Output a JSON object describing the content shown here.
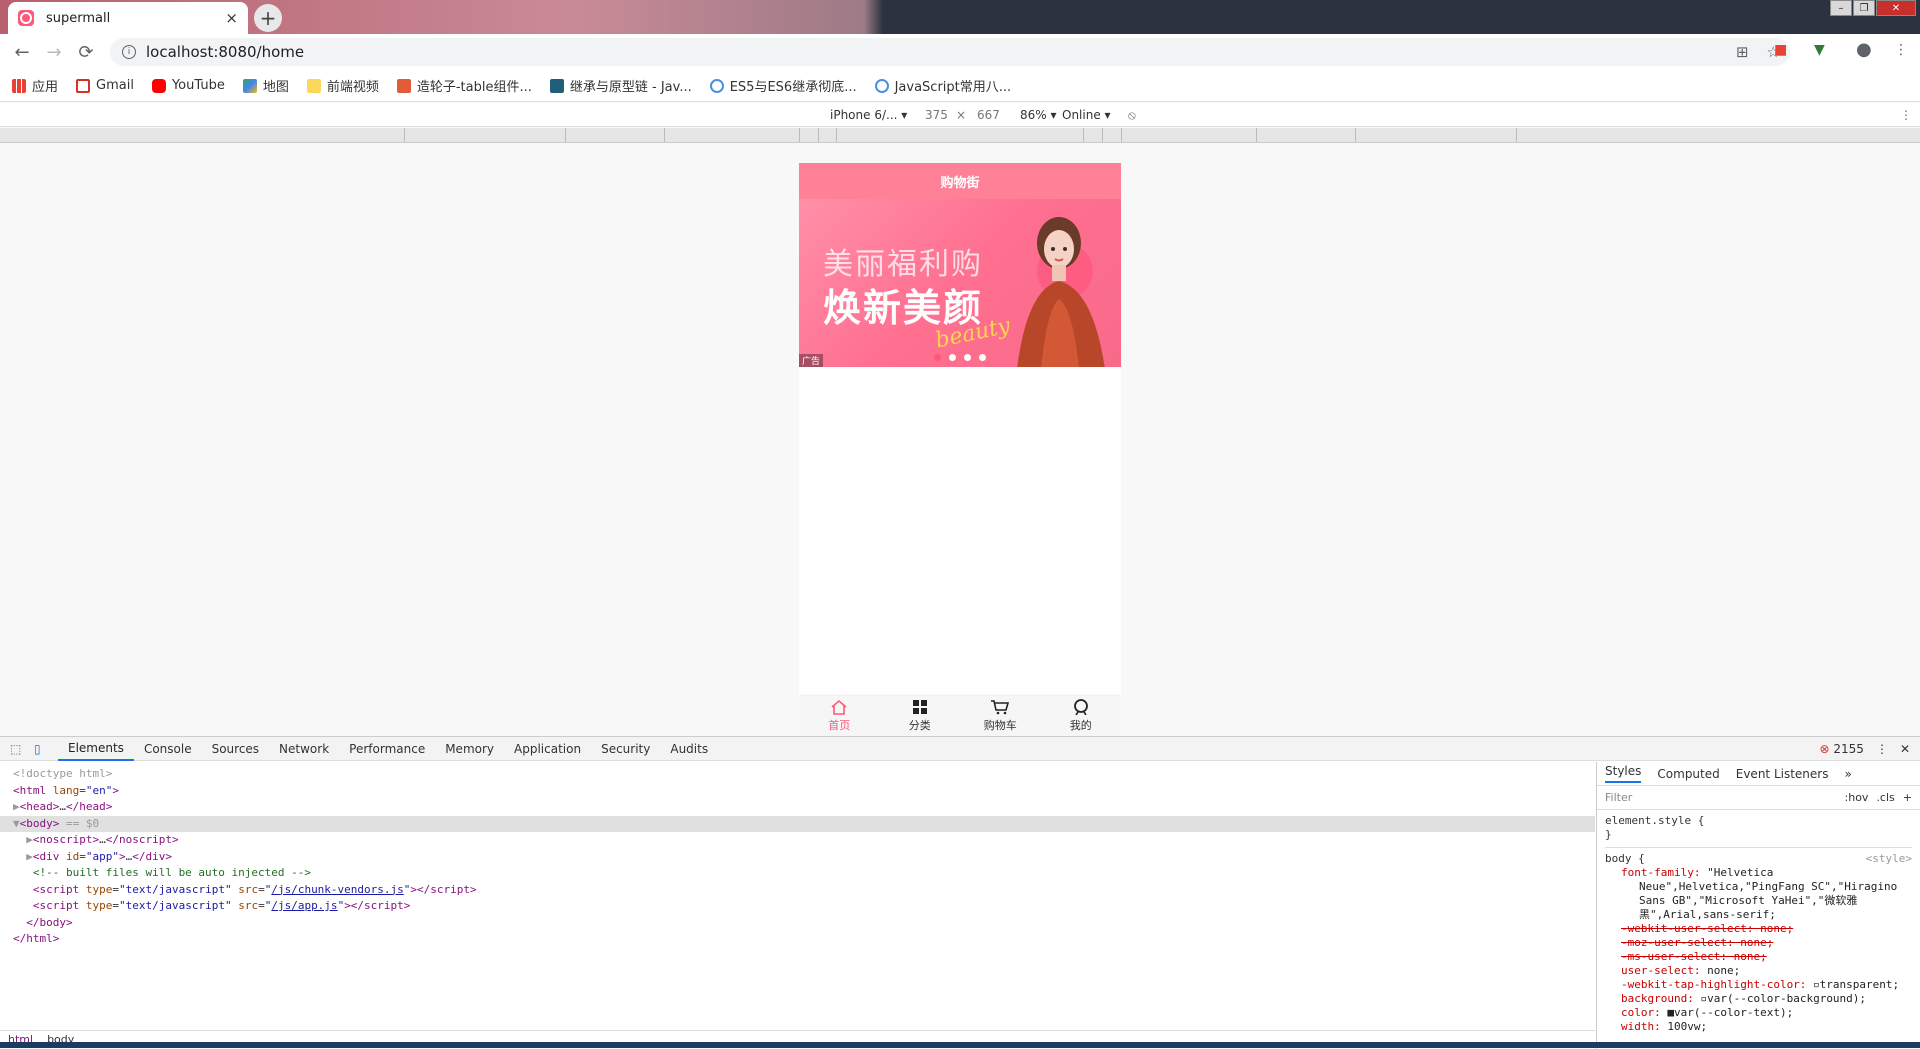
{
  "browser": {
    "tab_title": "supermall",
    "tab_close": "×",
    "new_tab": "+",
    "url": "localhost:8080/home",
    "bookmarks": [
      {
        "label": "应用",
        "color": "#e94235"
      },
      {
        "label": "Gmail",
        "color": "#d93025"
      },
      {
        "label": "YouTube",
        "color": "#ff0000"
      },
      {
        "label": "地图",
        "color": "#34a853"
      },
      {
        "label": "前端视频",
        "color": "#fbbc04"
      },
      {
        "label": "造轮子-table组件...",
        "color": "#e25c3c"
      },
      {
        "label": "继承与原型链 - Jav...",
        "color": "#1f5f7a"
      },
      {
        "label": "ES5与ES6继承彻底...",
        "color": "#4a90e2"
      },
      {
        "label": "JavaScript常用八...",
        "color": "#4a90e2"
      }
    ]
  },
  "device_toolbar": {
    "device": "iPhone 6/...",
    "width": "375",
    "times": "×",
    "height": "667",
    "zoom": "86%",
    "network": "Online"
  },
  "app": {
    "nav_title": "购物街",
    "banner": {
      "line1": "美丽福利购",
      "line2": "焕新美颜",
      "script": "beauty",
      "ad": "广告",
      "active_index": 0,
      "dot_count": 4
    },
    "tabbar": [
      {
        "label": "首页",
        "icon": "home-icon",
        "active": true
      },
      {
        "label": "分类",
        "icon": "category-icon",
        "active": false
      },
      {
        "label": "购物车",
        "icon": "cart-icon",
        "active": false
      },
      {
        "label": "我的",
        "icon": "profile-icon",
        "active": false
      }
    ],
    "accent_color": "#ff5777",
    "navbar_color": "#ff8198"
  },
  "devtools": {
    "tabs": [
      "Elements",
      "Console",
      "Sources",
      "Network",
      "Performance",
      "Memory",
      "Application",
      "Security",
      "Audits"
    ],
    "active_tab": "Elements",
    "error_count": "2155",
    "crumbs": [
      "html",
      "body"
    ],
    "style_tabs": [
      "Styles",
      "Computed",
      "Event Listeners",
      "»"
    ],
    "filter_placeholder": "Filter",
    "hov": ":hov",
    "cls": ".cls",
    "element_style": "element.style {",
    "body_rule": "body {",
    "body_source": "<style>"
  }
}
